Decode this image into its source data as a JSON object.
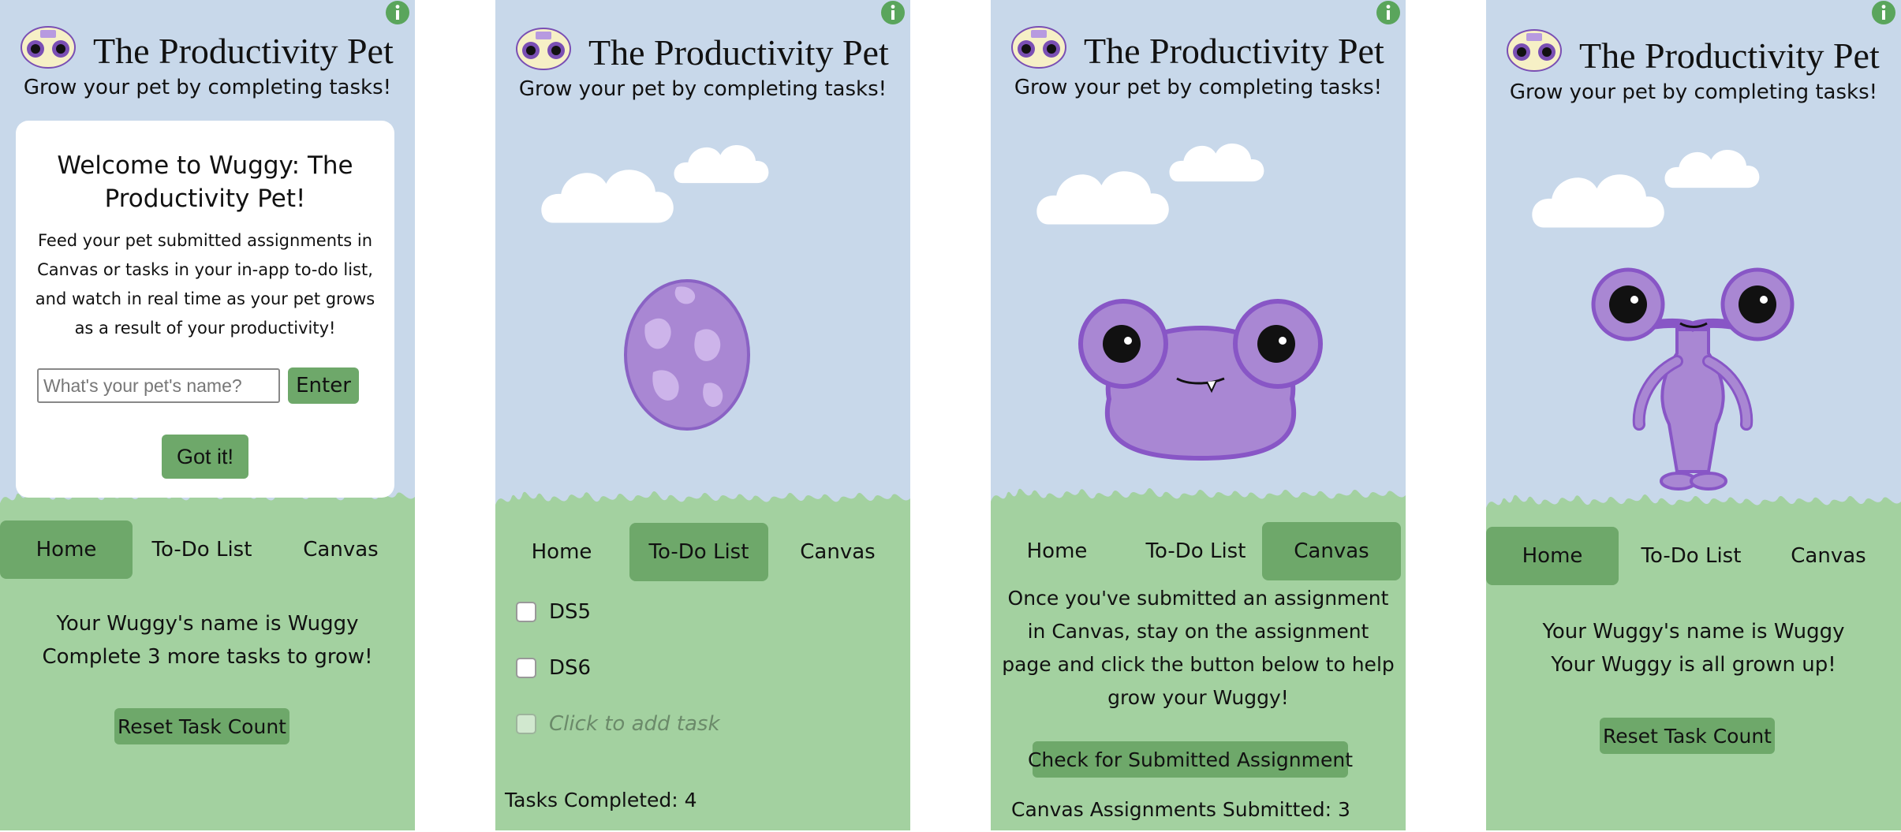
{
  "app": {
    "title": "The Productivity Pet",
    "subtitle": "Grow your pet by completing tasks!",
    "logo_text": "Wuggy"
  },
  "nav": {
    "home": "Home",
    "todo": "To-Do List",
    "canvas": "Canvas"
  },
  "icons": {
    "info": "info-icon",
    "logo": "wuggy-logo-icon"
  },
  "colors": {
    "sky": "#c8d8ea",
    "grass": "#a3d1a0",
    "accent_green": "#6ea86a",
    "pet_purple": "#a987d3",
    "pet_outline": "#8856c6"
  },
  "panel1": {
    "active_tab": "Home",
    "modal": {
      "title": "Welcome to Wuggy: The Productivity Pet!",
      "body": "Feed your pet submitted assignments in Canvas or tasks in your in-app to-do list, and watch in real time as your pet grows as a result of your productivity!",
      "input_placeholder": "What's your pet's name?",
      "enter_label": "Enter",
      "got_it_label": "Got it!"
    },
    "name_line": "Your Wuggy's name is Wuggy",
    "status_line": "Complete 3 more tasks to grow!",
    "reset_label": "Reset Task Count"
  },
  "panel2": {
    "active_tab": "To-Do List",
    "pet_stage": "egg",
    "tasks": [
      {
        "label": "DS5",
        "checked": false
      },
      {
        "label": "DS6",
        "checked": false
      }
    ],
    "add_task_placeholder": "Click to add task",
    "tasks_completed": "Tasks Completed: 4"
  },
  "panel3": {
    "active_tab": "Canvas",
    "pet_stage": "blob",
    "instructions": "Once you've submitted an assignment in Canvas, stay on the assignment page and click the button below to help grow your Wuggy!",
    "check_label": "Check for Submitted Assignment",
    "submitted_count": "Canvas Assignments Submitted: 3"
  },
  "panel4": {
    "active_tab": "Home",
    "pet_stage": "grown",
    "name_line": "Your Wuggy's name is Wuggy",
    "status_line": "Your Wuggy is all grown up!",
    "reset_label": "Reset Task Count"
  }
}
